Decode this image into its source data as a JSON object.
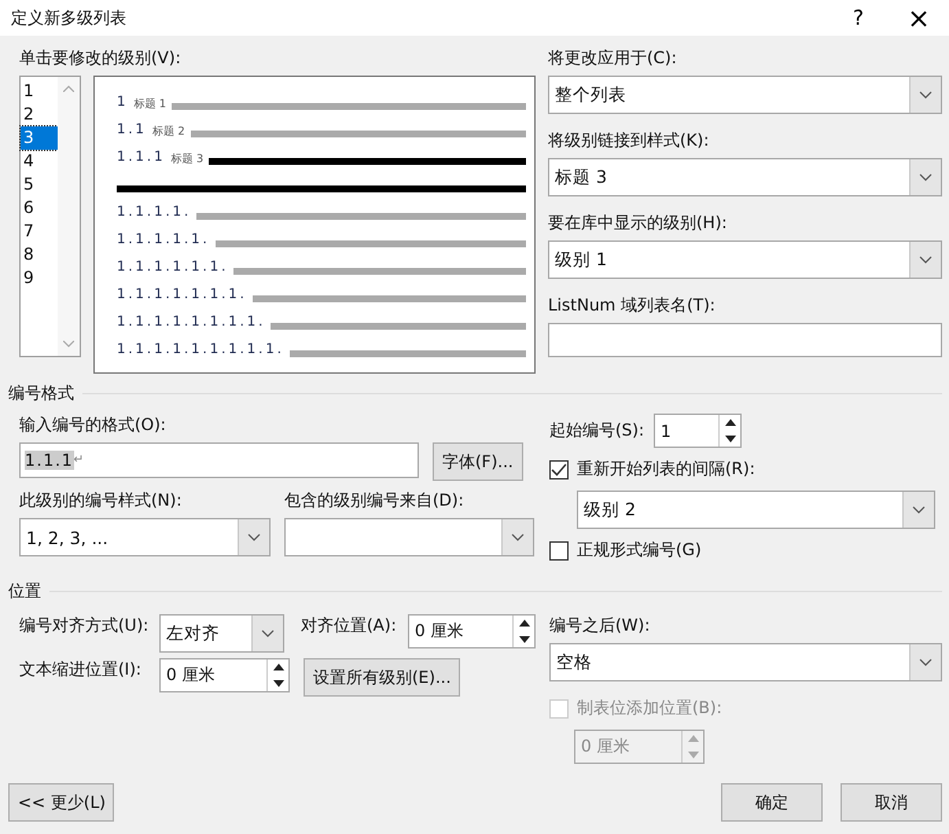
{
  "window": {
    "title": "定义新多级列表",
    "help": "?",
    "close": "×"
  },
  "levels": {
    "label": "单击要修改的级别(V):",
    "items": [
      {
        "label": "1",
        "selected": false
      },
      {
        "label": "2",
        "selected": false
      },
      {
        "label": "3",
        "selected": true
      },
      {
        "label": "4",
        "selected": false
      },
      {
        "label": "5",
        "selected": false
      },
      {
        "label": "6",
        "selected": false
      },
      {
        "label": "7",
        "selected": false
      },
      {
        "label": "8",
        "selected": false
      },
      {
        "label": "9",
        "selected": false
      }
    ]
  },
  "preview": [
    {
      "number": "1",
      "heading": "标题 1",
      "selected": false
    },
    {
      "number": "1.1",
      "heading": "标题 2",
      "selected": false
    },
    {
      "number": "1.1.1",
      "heading": "标题 3",
      "selected": true
    },
    {
      "number": "1.1.1.1.",
      "selected": false
    },
    {
      "number": "1.1.1.1.1.",
      "selected": false
    },
    {
      "number": "1.1.1.1.1.1.",
      "selected": false
    },
    {
      "number": "1.1.1.1.1.1.1.",
      "selected": false
    },
    {
      "number": "1.1.1.1.1.1.1.1.",
      "selected": false
    },
    {
      "number": "1.1.1.1.1.1.1.1.1.",
      "selected": false
    }
  ],
  "right_fields": [
    {
      "label": "将更改应用于(C):",
      "kind": "dropdown",
      "value": "整个列表"
    },
    {
      "label": "将级别链接到样式(K):",
      "kind": "dropdown",
      "value": "标题 3"
    },
    {
      "label": "要在库中显示的级别(H):",
      "kind": "dropdown",
      "value": "级别 1"
    },
    {
      "label": "ListNum 域列表名(T):",
      "kind": "text"
    }
  ],
  "number_format": {
    "heading": "编号格式",
    "format_label": "输入编号的格式(O):",
    "format_value": "1.1.1",
    "format_mark": "↵",
    "font_button": "字体(F)...",
    "style_label": "此级别的编号样式(N):",
    "style_value": "1, 2, 3, ...",
    "include_label": "包含的级别编号来自(D):",
    "start_label": "起始编号(S):",
    "start_value": "1",
    "restart_label": "重新开始列表的间隔(R):",
    "restart_checked": true,
    "restart_value": "级别 2",
    "legal_label": "正规形式编号(G)",
    "legal_checked": false
  },
  "position": {
    "heading": "位置",
    "align_label": "编号对齐方式(U):",
    "align_value": "左对齐",
    "at_label": "对齐位置(A):",
    "at_value": "0 厘米",
    "indent_label": "文本缩进位置(I):",
    "indent_value": "0 厘米",
    "set_all_button": "设置所有级别(E)...",
    "follow_label": "编号之后(W):",
    "follow_value": "空格",
    "tab_label": "制表位添加位置(B):",
    "tab_checked": false,
    "tab_disabled": true,
    "tab_value": "0 厘米"
  },
  "buttons": {
    "less": "<< 更少(L)",
    "ok": "确定",
    "cancel": "取消"
  }
}
